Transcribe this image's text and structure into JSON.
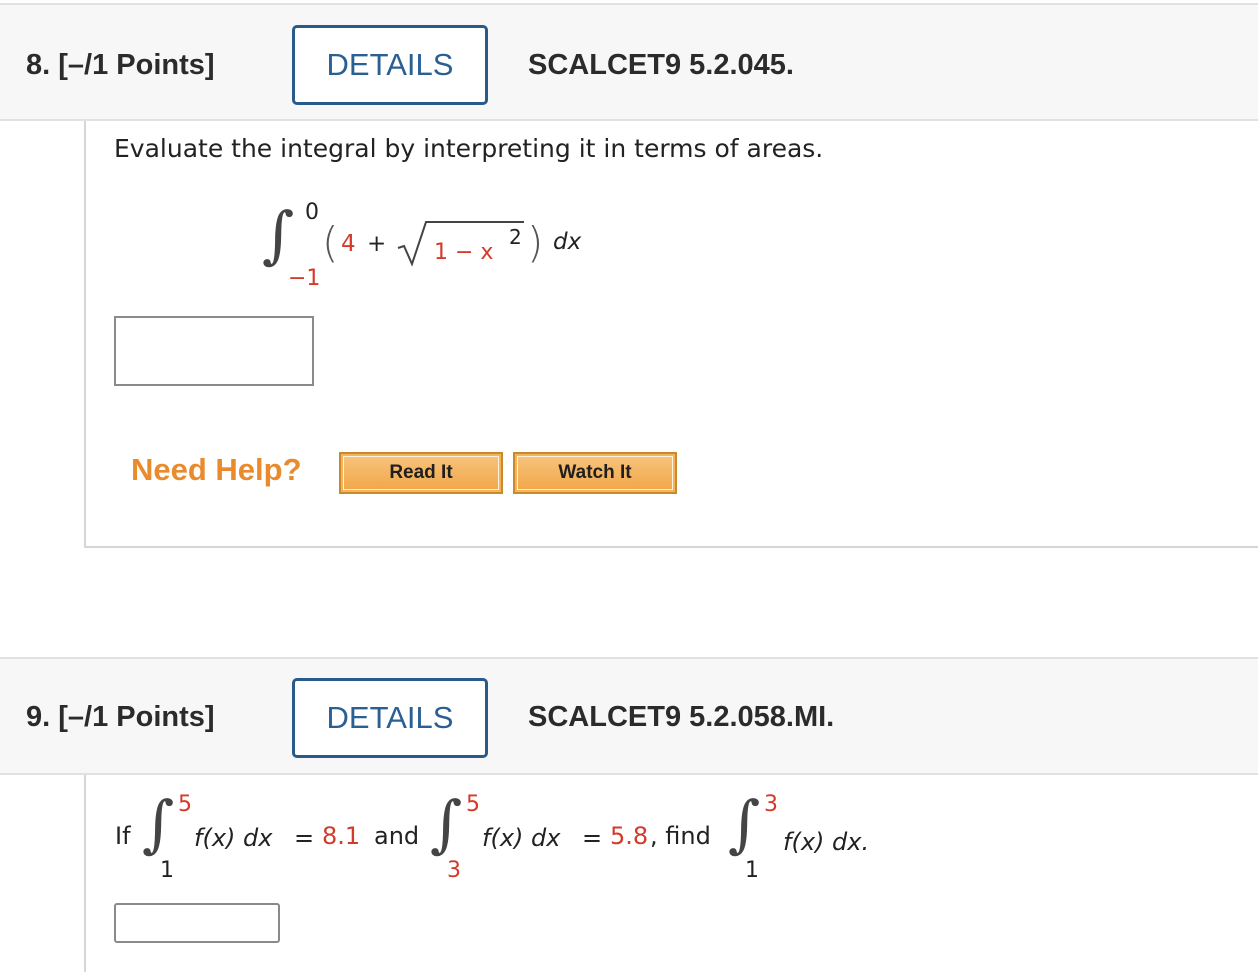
{
  "q8": {
    "number": "8. [–/1 Points]",
    "details_label": "DETAILS",
    "code": "SCALCET9 5.2.045.",
    "prompt": "Evaluate the integral by interpreting it in terms of areas.",
    "integral": {
      "upper": "0",
      "lower": "−1",
      "open_paren": "(",
      "term1": "4",
      "plus": "+",
      "radicand": "1 − x",
      "exponent": "2",
      "close_paren": ")",
      "dx": "dx"
    },
    "answer_value": "",
    "need_help": "Need Help?",
    "read_it": "Read It",
    "watch_it": "Watch It"
  },
  "q9": {
    "number": "9. [–/1 Points]",
    "details_label": "DETAILS",
    "code": "SCALCET9 5.2.058.MI.",
    "if": "If",
    "i1_upper": "5",
    "i1_lower": "1",
    "i1_integrand": "f(x) dx",
    "eq1": "=",
    "val1": "8.1",
    "and": "and",
    "i2_upper": "5",
    "i2_lower": "3",
    "i2_integrand": "f(x) dx",
    "eq2": "=",
    "val2": "5.8",
    "find": ", find",
    "i3_upper": "3",
    "i3_lower": "1",
    "i3_integrand": "f(x) dx.",
    "answer_value": ""
  },
  "colors": {
    "details_border": "#2a5a8a",
    "details_text": "#2a5f94",
    "need_help": "#e98a2c",
    "help_button": "#f5b35a",
    "red_value": "#d43a2a"
  }
}
